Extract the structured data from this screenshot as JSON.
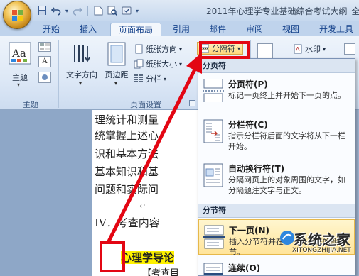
{
  "window": {
    "title": "2011年心理学专业基础综合考试大纲_全"
  },
  "tabs": [
    "开始",
    "插入",
    "页面布局",
    "引用",
    "邮件",
    "审阅",
    "视图",
    "开发工具"
  ],
  "active_tab": "页面布局",
  "ribbon": {
    "theme": {
      "label": "主题",
      "group_label": "主题"
    },
    "page_setup": {
      "group_label": "页面设置",
      "text_direction": "文字方向",
      "margins": "页边距",
      "orientation": "纸张方向",
      "size": "纸张大小",
      "columns": "分栏",
      "breaks": "分隔符"
    },
    "watermark": "水印"
  },
  "document": {
    "lines": [
      "理统计和测量",
      "统掌握上述心",
      "识和基本方法",
      "基本知识和基",
      "问题和实际问"
    ],
    "heading": "IV．考查内容",
    "highlighted": "心理学导论",
    "sub": "【考查目"
  },
  "breaks_menu": {
    "section_page": "分页符",
    "section_section": "分节符",
    "items": [
      {
        "title": "分页符(P)",
        "desc": "标记一页终止并开始下一页的点。"
      },
      {
        "title": "分栏符(C)",
        "desc": "指示分栏符后面的文字将从下一栏开始。"
      },
      {
        "title": "自动换行符(T)",
        "desc": "分隔网页上的对象周围的文字，如分隔题注文字与正文。"
      },
      {
        "title": "下一页(N)",
        "desc": "插入分节符并在下一页上开始新节。"
      },
      {
        "title": "连续(O)",
        "desc": ""
      }
    ]
  },
  "watermark_overlay": {
    "main": "系统之家",
    "sub": "XITONGZHIJIA.NET"
  },
  "colors": {
    "annotation_red": "#e30613",
    "highlight_yellow": "#fff200",
    "ribbon_blue": "#15428b"
  }
}
